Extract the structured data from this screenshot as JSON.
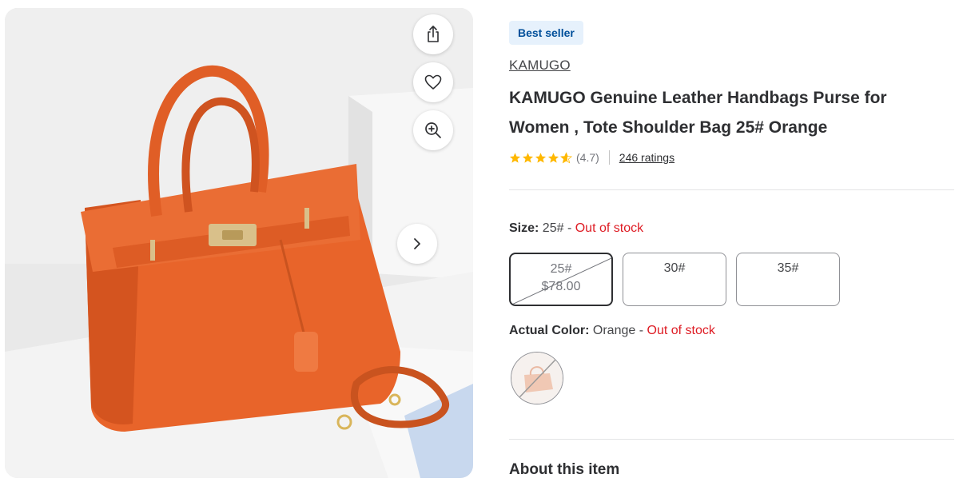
{
  "product_image": {
    "alt": "Orange leather handbag",
    "actions": {
      "share_icon": "share-icon",
      "favorite_icon": "heart-icon",
      "zoom_icon": "zoom-in-icon",
      "next_icon": "chevron-right-icon"
    }
  },
  "badge": "Best seller",
  "brand": "KAMUGO",
  "title": "KAMUGO Genuine Leather Handbags Purse for Women , Tote Shoulder Bag 25# Orange",
  "rating": {
    "stars": 4.7,
    "value_text": "(4.7)",
    "count_text": "246 ratings"
  },
  "size": {
    "label": "Size:",
    "value": "25#",
    "separator": " - ",
    "status": "Out of stock",
    "options": [
      {
        "label": "25#",
        "price": "$78.00",
        "selected": true,
        "unavailable": true
      },
      {
        "label": "30#",
        "price": ""
      },
      {
        "label": "35#",
        "price": ""
      }
    ]
  },
  "color": {
    "label": "Actual Color:",
    "value": "Orange",
    "separator": " - ",
    "status": "Out of stock",
    "swatch_name": "Orange"
  },
  "about_heading": "About this item",
  "colors": {
    "badge_bg": "#e6f1fc",
    "badge_text": "#004f9a",
    "out_of_stock": "#de1c24",
    "star": "#ffb800",
    "bag": "#e8642a"
  }
}
